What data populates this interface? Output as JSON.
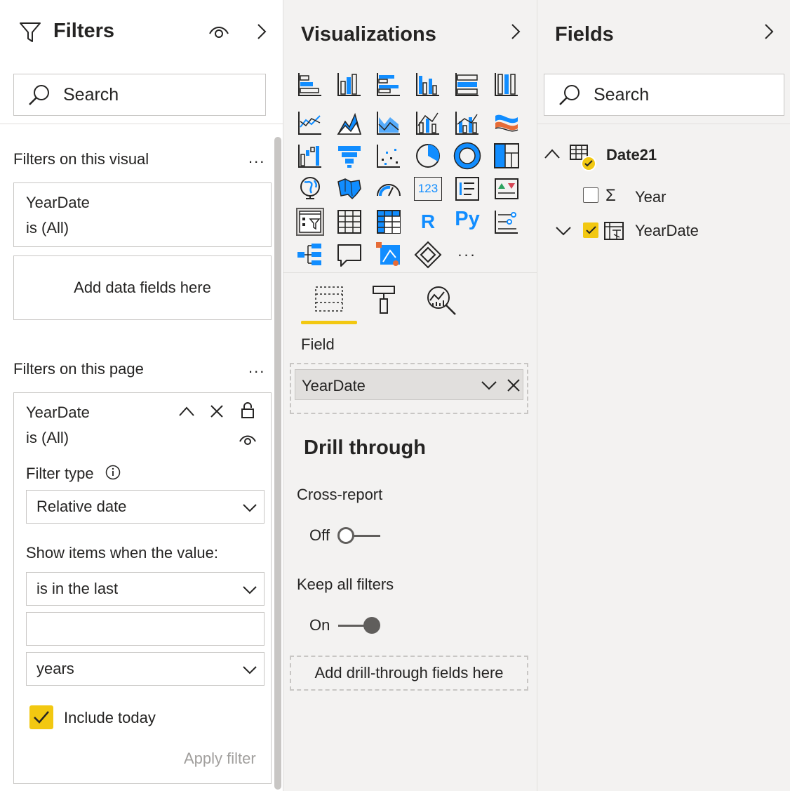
{
  "filters_pane": {
    "title": "Filters",
    "search_placeholder": "Search",
    "visual_section_label": "Filters on this visual",
    "visual_more": "...",
    "visual_card": {
      "field": "YearDate",
      "condition": "is (All)"
    },
    "add_fields_label": "Add data fields here",
    "page_section_label": "Filters on this page",
    "page_more": "...",
    "page_card": {
      "field": "YearDate",
      "condition": "is (All)",
      "filter_type_label": "Filter type",
      "filter_type_value": "Relative date",
      "show_items_label": "Show items when the value:",
      "operator_value": "is in the last",
      "number_value": "",
      "unit_value": "years",
      "include_today_label": "Include today",
      "include_today_checked": true,
      "apply_label": "Apply filter"
    }
  },
  "viz_pane": {
    "title": "Visualizations",
    "more_icons": "...",
    "r_label": "R",
    "py_label": "Py",
    "card_label": "123",
    "field_section_label": "Field",
    "field_value": "YearDate",
    "drill_title": "Drill through",
    "cross_report_label": "Cross-report",
    "cross_report_state": "Off",
    "keep_filters_label": "Keep all filters",
    "keep_filters_state": "On",
    "drill_add_label": "Add drill-through fields here"
  },
  "fields_pane": {
    "title": "Fields",
    "search_placeholder": "Search",
    "table_name": "Date21",
    "fields": [
      {
        "name": "Year",
        "checked": false
      },
      {
        "name": "YearDate",
        "checked": true
      }
    ]
  },
  "colors": {
    "accent_yellow": "#f2c811",
    "icon_blue": "#118dff",
    "text": "#252423",
    "muted": "#a19f9d"
  }
}
